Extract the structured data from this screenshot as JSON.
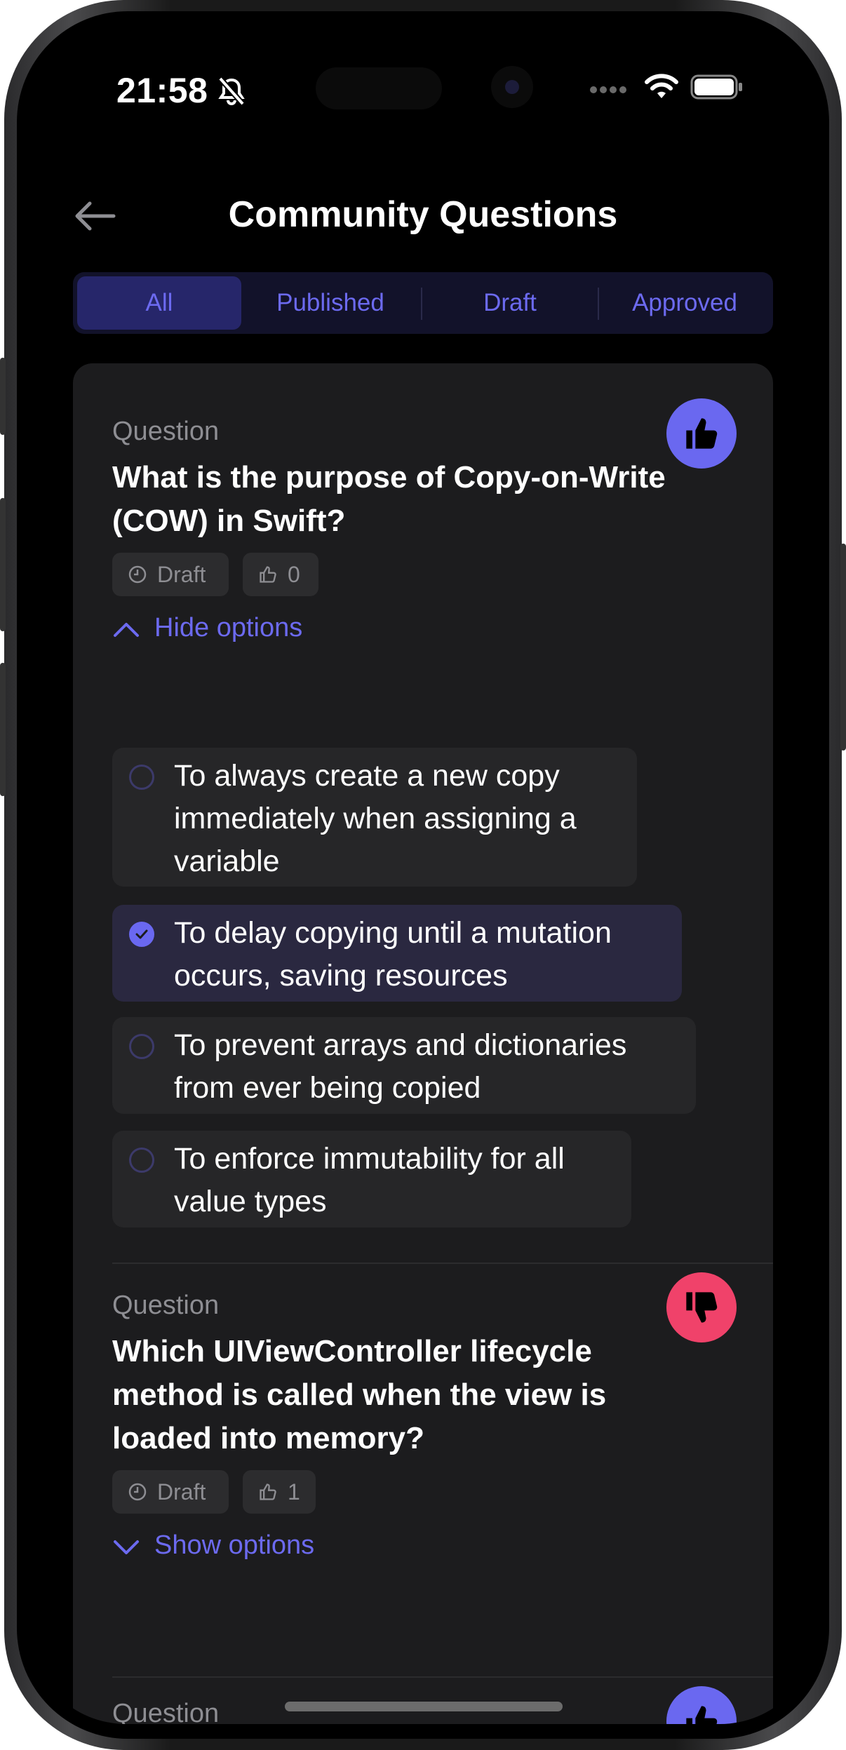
{
  "status_bar": {
    "time": "21:58"
  },
  "header": {
    "title": "Community Questions"
  },
  "filter_tabs": [
    "All",
    "Published",
    "Draft",
    "Approved"
  ],
  "questions": [
    {
      "label": "Question",
      "text_lines": [
        "What is the purpose of Copy-on-Write",
        "(COW) in Swift?"
      ],
      "status": "Draft",
      "likes": "0",
      "toggle_label": "Hide options",
      "options": [
        {
          "lines": [
            "To always create a new copy",
            "immediately when assigning a",
            "variable"
          ]
        },
        {
          "lines": [
            "To delay copying until a mutation",
            "occurs, saving resources"
          ],
          "selected": true
        },
        {
          "lines": [
            "To prevent arrays and dictionaries",
            "from ever being copied"
          ]
        },
        {
          "lines": [
            "To enforce immutability for all",
            "value types"
          ]
        }
      ],
      "reaction_icon": "thumbs-up-icon"
    },
    {
      "label": "Question",
      "text_lines": [
        "Which UIViewController lifecycle",
        "method is called when the view is",
        "loaded into memory?"
      ],
      "status": "Draft",
      "likes": "1",
      "toggle_label": "Show options",
      "reaction_icon": "thumbs-down-icon"
    },
    {
      "label": "Question",
      "reaction_icon": "thumbs-up-icon"
    }
  ],
  "colors": {
    "accent": "#6a68f0",
    "dislike": "#f0426a",
    "card": "#1c1c1e",
    "background": "#000000"
  }
}
